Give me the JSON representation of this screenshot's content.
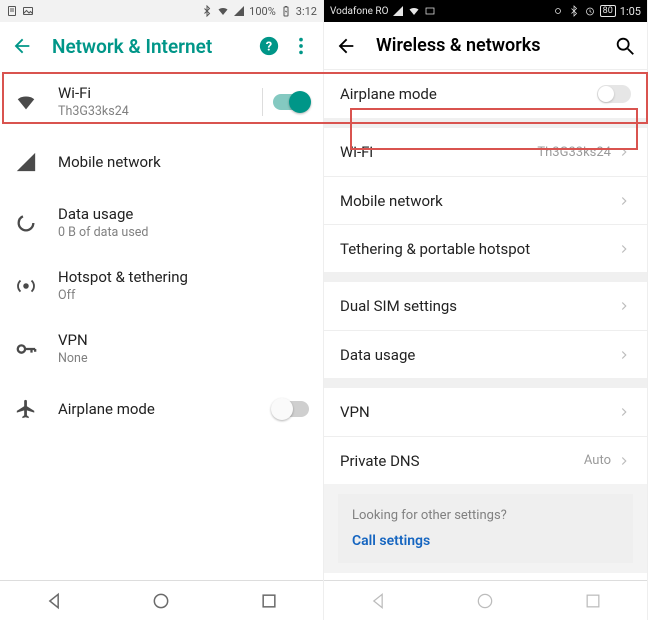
{
  "left": {
    "statusbar": {
      "battery": "100%",
      "time": "3:12"
    },
    "header": {
      "title": "Network & Internet"
    },
    "items": {
      "wifi": {
        "label": "Wi-Fi",
        "sub": "Th3G33ks24"
      },
      "mobile": {
        "label": "Mobile network"
      },
      "data": {
        "label": "Data usage",
        "sub": "0 B of data used"
      },
      "hotspot": {
        "label": "Hotspot & tethering",
        "sub": "Off"
      },
      "vpn": {
        "label": "VPN",
        "sub": "None"
      },
      "air": {
        "label": "Airplane mode"
      }
    }
  },
  "right": {
    "statusbar": {
      "carrier": "Vodafone RO",
      "battery": "80",
      "time": "1:05"
    },
    "header": {
      "title": "Wireless & networks"
    },
    "items": {
      "air": {
        "label": "Airplane mode"
      },
      "wifi": {
        "label": "Wi-Fi",
        "value": "Th3G33ks24"
      },
      "mobile": {
        "label": "Mobile network"
      },
      "tether": {
        "label": "Tethering & portable hotspot"
      },
      "dual": {
        "label": "Dual SIM settings"
      },
      "data": {
        "label": "Data usage"
      },
      "vpn": {
        "label": "VPN"
      },
      "dns": {
        "label": "Private DNS",
        "value": "Auto"
      }
    },
    "footer": {
      "q": "Looking for other settings?",
      "link": "Call settings"
    }
  }
}
